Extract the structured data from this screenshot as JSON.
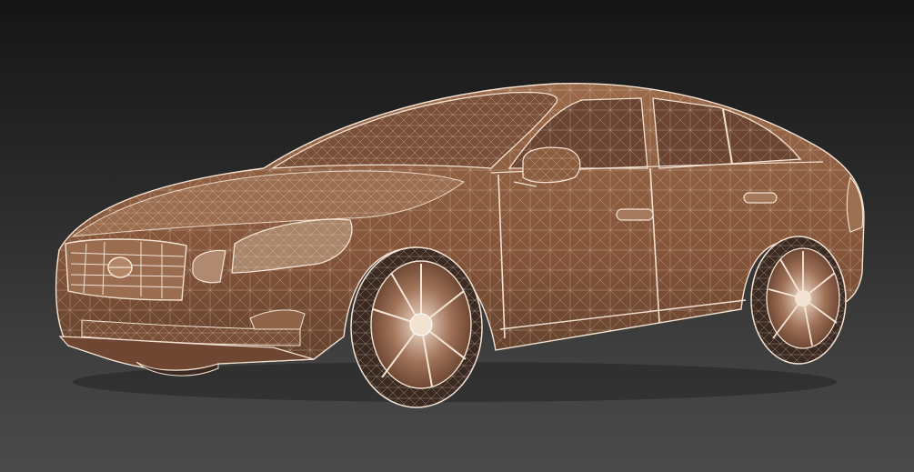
{
  "scene": {
    "subject": "car-wireframe-render",
    "background": {
      "top": "#151515",
      "bottom": "#4a4a4a"
    },
    "colors": {
      "body": "#8a5a3c",
      "body_dark": "#5e3a24",
      "glass": "#6e4a34",
      "wire": "#f3e2d2",
      "tire": "#3a2a22"
    },
    "icons": [
      "car-icon",
      "wheel-icon",
      "grille-icon",
      "mirror-icon"
    ]
  }
}
